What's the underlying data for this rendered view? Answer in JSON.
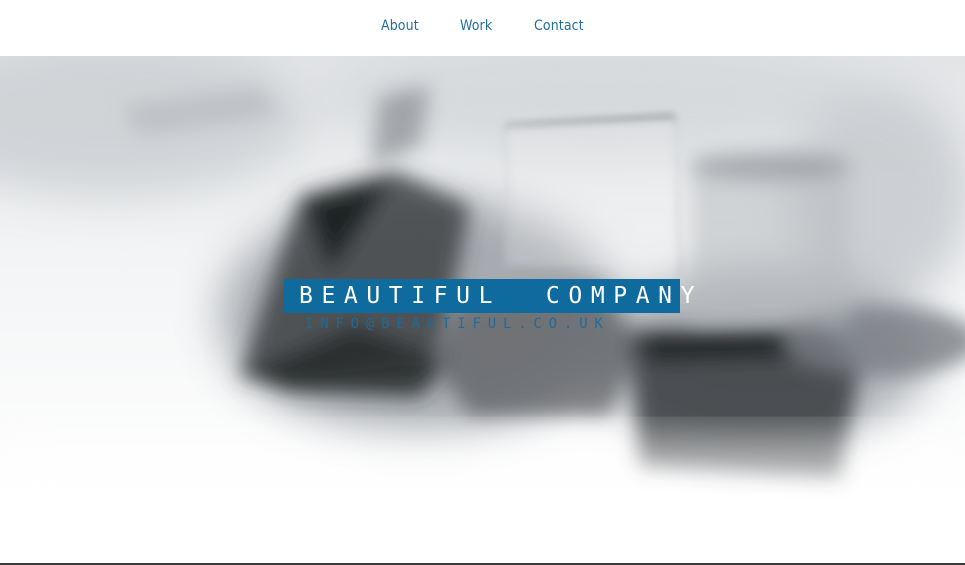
{
  "nav": {
    "items": [
      {
        "label": "About"
      },
      {
        "label": "Work"
      },
      {
        "label": "Contact"
      }
    ]
  },
  "hero": {
    "title": "BEAUTIFUL  COMPANY",
    "email": "INFO@BEAUTIFUL.CO.UK"
  },
  "colors": {
    "accent": "#0f6a9d",
    "nav_link": "#1f6f9e",
    "background": "#ffffff"
  }
}
